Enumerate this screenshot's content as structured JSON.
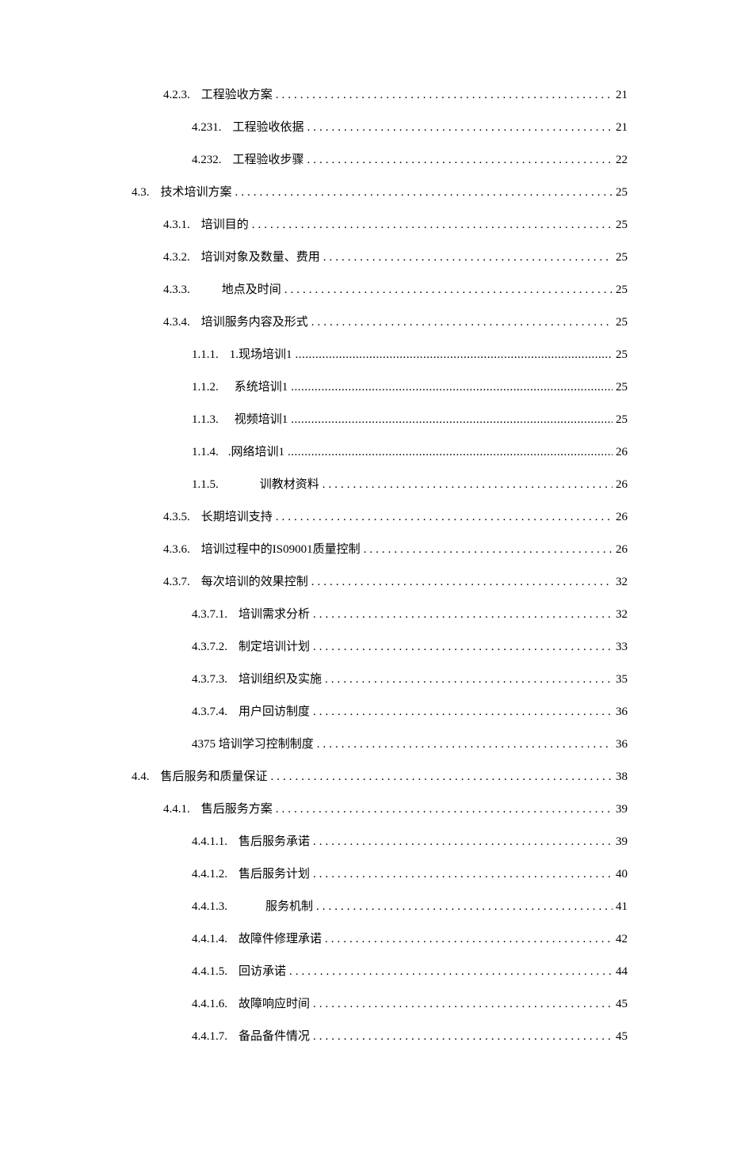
{
  "entries": [
    {
      "indent": 1,
      "num": "4.2.3.",
      "title": "工程验收方案",
      "page": "21",
      "dotStyle": "dots-wide"
    },
    {
      "indent": 2,
      "num": "4.231.",
      "title": "工程验收依据",
      "page": "21",
      "dotStyle": "dots-wide"
    },
    {
      "indent": 2,
      "num": "4.232.",
      "title": "工程验收步骤",
      "page": "22",
      "dotStyle": "dots-wide"
    },
    {
      "indent": 0,
      "num": "4.3.",
      "title": "技术培训方案",
      "page": "25",
      "dotStyle": "dots-wide"
    },
    {
      "indent": 1,
      "num": "4.3.1.",
      "title": "培训目的",
      "page": "25",
      "dotStyle": "dots-wide"
    },
    {
      "indent": 1,
      "num": "4.3.2.",
      "title": "培训对象及数量、费用",
      "page": "25",
      "dotStyle": "dots-wide"
    },
    {
      "indent": 1,
      "num": "4.3.3.",
      "title": "地点及时间",
      "page": "25",
      "dotStyle": "dots-wide",
      "titlePad": 40
    },
    {
      "indent": 1,
      "num": "4.3.4.",
      "title": "培训服务内容及形式",
      "page": "25",
      "dotStyle": "dots-wide"
    },
    {
      "indent": 2,
      "num": "1.1.1.",
      "title": "1.现场培训1",
      "page": "25",
      "dotStyle": "dots-tight"
    },
    {
      "indent": 2,
      "num": "1.1.2.",
      "title": "系统培训1",
      "page": "25",
      "dotStyle": "dots-tight",
      "titlePad": 20
    },
    {
      "indent": 2,
      "num": "1.1.3.",
      "title": "视频培训1",
      "page": "25",
      "dotStyle": "dots-tight",
      "titlePad": 20
    },
    {
      "indent": 2,
      "num": "1.1.4.",
      "title": ".网络培训1",
      "page": "26",
      "dotStyle": "dots-tight",
      "titlePad": 12
    },
    {
      "indent": 2,
      "num": "1.1.5.",
      "title": "训教材资料",
      "page": "26",
      "dotStyle": "dots-wide",
      "titlePad": 52
    },
    {
      "indent": 1,
      "num": "4.3.5.",
      "title": "长期培训支持",
      "page": "26",
      "dotStyle": "dots-wide"
    },
    {
      "indent": 1,
      "num": "4.3.6.",
      "title": "培训过程中的IS09001质量控制",
      "page": "26",
      "dotStyle": "dots-wide"
    },
    {
      "indent": 1,
      "num": "4.3.7.",
      "title": "每次培训的效果控制",
      "page": "32",
      "dotStyle": "dots-wide"
    },
    {
      "indent": 2,
      "num": "4.3.7.1.",
      "title": "培训需求分析",
      "page": "32",
      "dotStyle": "dots-wide"
    },
    {
      "indent": 2,
      "num": "4.3.7.2.",
      "title": "制定培训计划",
      "page": "33",
      "dotStyle": "dots-wide"
    },
    {
      "indent": 2,
      "num": "4.3.7.3.",
      "title": "培训组织及实施",
      "page": "35",
      "dotStyle": "dots-wide"
    },
    {
      "indent": 2,
      "num": "4.3.7.4.",
      "title": "用户回访制度",
      "page": "36",
      "dotStyle": "dots-wide"
    },
    {
      "indent": 2,
      "num": "",
      "title": "4375 培训学习控制制度",
      "page": "36",
      "dotStyle": "dots-wide",
      "noGap": true
    },
    {
      "indent": 0,
      "num": "4.4.",
      "title": "售后服务和质量保证",
      "page": "38",
      "dotStyle": "dots-wide"
    },
    {
      "indent": 1,
      "num": "4.4.1.",
      "title": "售后服务方案",
      "page": "39",
      "dotStyle": "dots-wide"
    },
    {
      "indent": 2,
      "num": "4.4.1.1.",
      "title": "售后服务承诺",
      "page": "39",
      "dotStyle": "dots-wide"
    },
    {
      "indent": 2,
      "num": "4.4.1.2.",
      "title": "售后服务计划",
      "page": "40",
      "dotStyle": "dots-wide"
    },
    {
      "indent": 2,
      "num": "4.4.1.3.",
      "title": "服务机制",
      "page": "41",
      "dotStyle": "dots-wide",
      "titlePad": 48
    },
    {
      "indent": 2,
      "num": "4.4.1.4.",
      "title": "故障件修理承诺",
      "page": "42",
      "dotStyle": "dots-wide"
    },
    {
      "indent": 2,
      "num": "4.4.1.5.",
      "title": "回访承诺",
      "page": "44",
      "dotStyle": "dots-wide"
    },
    {
      "indent": 2,
      "num": "4.4.1.6.",
      "title": "故障响应时间",
      "page": "45",
      "dotStyle": "dots-wide"
    },
    {
      "indent": 2,
      "num": "4.4.1.7.",
      "title": "备品备件情况",
      "page": "45",
      "dotStyle": "dots-wide"
    }
  ]
}
